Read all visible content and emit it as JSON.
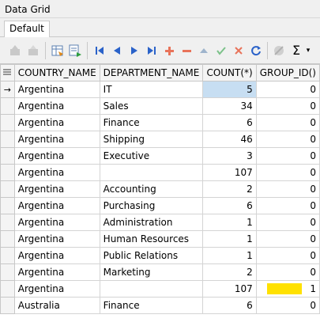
{
  "window": {
    "title": "Data Grid"
  },
  "tabs": [
    {
      "label": "Default"
    }
  ],
  "toolbar": {
    "icons": [
      "save-icon",
      "save-disabled-icon",
      "grid-refresh-icon",
      "grid-export-icon",
      "first-record-icon",
      "prior-record-icon",
      "next-record-icon",
      "last-record-icon",
      "add-record-icon",
      "delete-record-icon",
      "edit-up-icon",
      "post-check-icon",
      "cancel-x-icon",
      "refresh-icon",
      "filter-disabled-icon",
      "sum-icon",
      "dropdown-arrow-icon"
    ]
  },
  "grid": {
    "columns": [
      "COUNTRY_NAME",
      "DEPARTMENT_NAME",
      "COUNT(*)",
      "GROUP_ID()"
    ],
    "current_row_index": 0,
    "highlight_color": "#ffe100",
    "rows": [
      {
        "country": "Argentina",
        "department": "IT",
        "count": "5",
        "group_id": "0"
      },
      {
        "country": "Argentina",
        "department": "Sales",
        "count": "34",
        "group_id": "0"
      },
      {
        "country": "Argentina",
        "department": "Finance",
        "count": "6",
        "group_id": "0"
      },
      {
        "country": "Argentina",
        "department": "Shipping",
        "count": "46",
        "group_id": "0"
      },
      {
        "country": "Argentina",
        "department": "Executive",
        "count": "3",
        "group_id": "0"
      },
      {
        "country": "Argentina",
        "department": "",
        "count": "107",
        "group_id": "0"
      },
      {
        "country": "Argentina",
        "department": "Accounting",
        "count": "2",
        "group_id": "0"
      },
      {
        "country": "Argentina",
        "department": "Purchasing",
        "count": "6",
        "group_id": "0"
      },
      {
        "country": "Argentina",
        "department": "Administration",
        "count": "1",
        "group_id": "0"
      },
      {
        "country": "Argentina",
        "department": "Human Resources",
        "count": "1",
        "group_id": "0"
      },
      {
        "country": "Argentina",
        "department": "Public Relations",
        "count": "1",
        "group_id": "0"
      },
      {
        "country": "Argentina",
        "department": "Marketing",
        "count": "2",
        "group_id": "0"
      },
      {
        "country": "Argentina",
        "department": "",
        "count": "107",
        "group_id": "1",
        "highlight": true
      },
      {
        "country": "Australia",
        "department": "Finance",
        "count": "6",
        "group_id": "0"
      }
    ]
  }
}
